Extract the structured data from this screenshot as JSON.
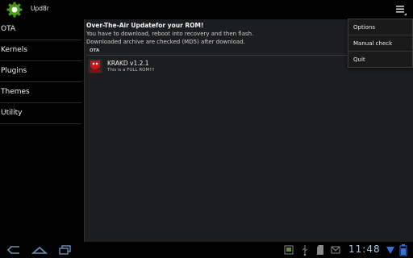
{
  "app": {
    "title": "Upd8r"
  },
  "sidebar": {
    "items": [
      {
        "label": "OTA"
      },
      {
        "label": "Kernels"
      },
      {
        "label": "Plugins"
      },
      {
        "label": "Themes"
      },
      {
        "label": "Utility"
      }
    ]
  },
  "main": {
    "title": "Over-The-Air Updatefor your ROM!",
    "line1": "You have to download, reboot into recovery and then flash.",
    "line2": "Downloaded archive are checked (MD5) after download.",
    "section_header": "OTA",
    "rom": {
      "icon_label": "KRAKD",
      "name": "KRAKD v1.2.1",
      "description": "This is a FULL ROM!!!"
    }
  },
  "menu": {
    "items": [
      {
        "label": "Options"
      },
      {
        "label": "Manual check"
      },
      {
        "label": "Quit"
      }
    ]
  },
  "system_bar": {
    "clock": "11:48",
    "buttons": [
      "back-icon",
      "home-icon",
      "recent-apps-icon"
    ],
    "status_icons": [
      "screenshot-icon",
      "usb-icon",
      "sd-card-icon",
      "notification-icon",
      "wifi-icon",
      "battery-icon"
    ]
  },
  "colors": {
    "panel_bg": "#1c1d1f",
    "accent_green": "#49a11a",
    "clock_color": "#a9c8e8",
    "rom_icon_red": "#c8141c"
  }
}
